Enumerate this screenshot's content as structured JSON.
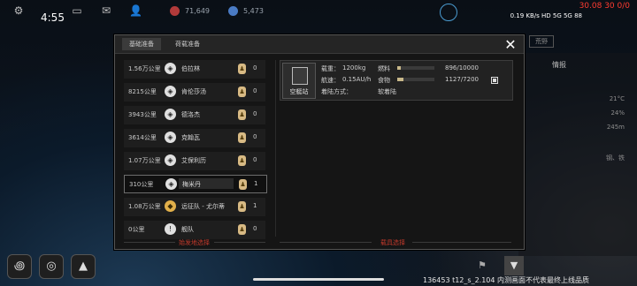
{
  "status_bar": {
    "time": "4:55",
    "resource_a": "71,649",
    "resource_b": "5,473",
    "system_icons": "0.19 KB/s HD 5G 5G 88",
    "debug_top": "30.08 30 0/0"
  },
  "modal": {
    "tabs": [
      "基础准备",
      "荷载准备"
    ],
    "departure_label": "始发地选择",
    "carrier_label": "载具选择",
    "departures": [
      {
        "distance": "1.56万公里",
        "name": "伯拉林",
        "icon": "diamond-white",
        "count": "0"
      },
      {
        "distance": "8215公里",
        "name": "肯伦莎汤",
        "icon": "diamond-white",
        "count": "0"
      },
      {
        "distance": "3943公里",
        "name": "德洛杰",
        "icon": "diamond-white",
        "count": "0"
      },
      {
        "distance": "3614公里",
        "name": "克翰瓦",
        "icon": "diamond-white",
        "count": "0"
      },
      {
        "distance": "1.07万公里",
        "name": "艾保利历",
        "icon": "diamond-white",
        "count": "0"
      },
      {
        "distance": "310公里",
        "name": "梅米丹",
        "icon": "diamond-white",
        "count": "1",
        "selected": true
      },
      {
        "distance": "1.08万公里",
        "name": "远征队 - 尤尔蒂",
        "icon": "expedition-gold",
        "count": "1"
      },
      {
        "distance": "0公里",
        "name": "舰队",
        "icon": "fleet-white",
        "count": "0"
      }
    ],
    "vehicle": {
      "name": "空艇站",
      "load_label": "载重：",
      "load_value": "1200kg",
      "speed_label": "航速：",
      "speed_value": "0.15AU/h",
      "landing_label": "着陆方式：",
      "landing_value": "软着陆",
      "fuel_label": "燃料",
      "fuel_value": "896/10000",
      "fuel_fraction": 0.0896,
      "food_label": "食物",
      "food_value": "1127/7200",
      "food_fraction": 0.1565
    }
  },
  "right_panel": {
    "header": "情报",
    "tag": "荒野",
    "values": [
      "21°C",
      "24%",
      "245m",
      "钢、铁"
    ]
  },
  "bottom": {
    "version": "136453 t12_s_2.104  内测画面不代表最终上线品质"
  },
  "icons": {
    "settings": "gear-icon",
    "chat": "chat-icon",
    "mail": "mail-icon",
    "profile": "person-icon",
    "close": "close-icon"
  },
  "colors": {
    "accent_red": "#c0392b",
    "gold": "#e2b04a"
  }
}
